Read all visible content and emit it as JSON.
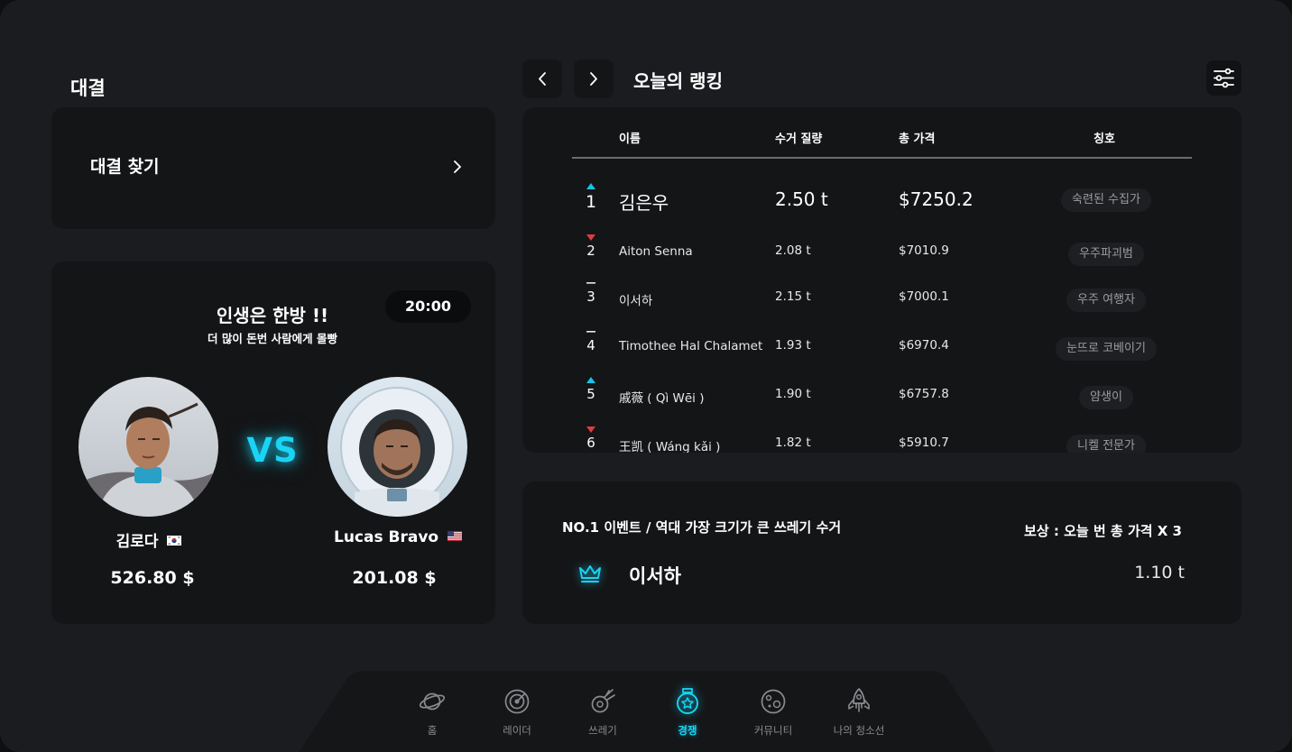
{
  "battle": {
    "section_title": "대결",
    "find_match_label": "대결 찾기",
    "headline": "인생은 한방 !!",
    "subline": "더 많이 돈번 사람에게 몰빵",
    "timer": "20:00",
    "vs_label": "VS",
    "player_left": {
      "name": "김로다",
      "flag": "korea-flag-icon",
      "amount": "526.80 $"
    },
    "player_right": {
      "name": "Lucas Bravo",
      "flag": "usa-flag-icon",
      "amount": "201.08 $"
    }
  },
  "ranking": {
    "title": "오늘의 랭킹",
    "columns": {
      "name": "이름",
      "weight": "수거 질량",
      "price": "총 가격",
      "title": "칭호"
    },
    "rows": [
      {
        "rank": "1",
        "trend": "up",
        "name": "김은우",
        "weight": "2.50 t",
        "price": "$7250.2",
        "title": "숙련된 수집가"
      },
      {
        "rank": "2",
        "trend": "down",
        "name": "Aiton Senna",
        "weight": "2.08 t",
        "price": "$7010.9",
        "title": "우주파괴범"
      },
      {
        "rank": "3",
        "trend": "same",
        "name": "이서하",
        "weight": "2.15 t",
        "price": "$7000.1",
        "title": "우주 여행자"
      },
      {
        "rank": "4",
        "trend": "same",
        "name": "Timothee Hal Chalamet",
        "weight": "1.93 t",
        "price": "$6970.4",
        "title": "눈뜨로 코베이기"
      },
      {
        "rank": "5",
        "trend": "up",
        "name": "戚薇 ( Qì Wēi )",
        "weight": "1.90 t",
        "price": "$6757.8",
        "title": "얌생이"
      },
      {
        "rank": "6",
        "trend": "down",
        "name": "王凯 ( Wáng kǎi )",
        "weight": "1.82 t",
        "price": "$5910.7",
        "title": "니켈 전문가"
      }
    ]
  },
  "event": {
    "headline": "NO.1 이벤트  /  역대 가장 크기가 큰 쓰레기 수거",
    "reward": "보상 : 오늘 번 총 가격 X 3",
    "winner_name": "이서하",
    "winner_value": "1.10 t"
  },
  "bottom_nav": {
    "items": [
      {
        "label": "홈",
        "icon": "planet-icon"
      },
      {
        "label": "레이더",
        "icon": "radar-icon"
      },
      {
        "label": "쓰레기",
        "icon": "comet-icon"
      },
      {
        "label": "경쟁",
        "icon": "medal-icon",
        "active": true
      },
      {
        "label": "커뮤니티",
        "icon": "moon-icon"
      },
      {
        "label": "나의 청소선",
        "icon": "rocket-icon"
      }
    ]
  },
  "colors": {
    "accent": "#19d4f5",
    "trend_up": "#19c3e6",
    "trend_down": "#e23b3b",
    "card": "#141517",
    "background": "#1b1c1f"
  }
}
